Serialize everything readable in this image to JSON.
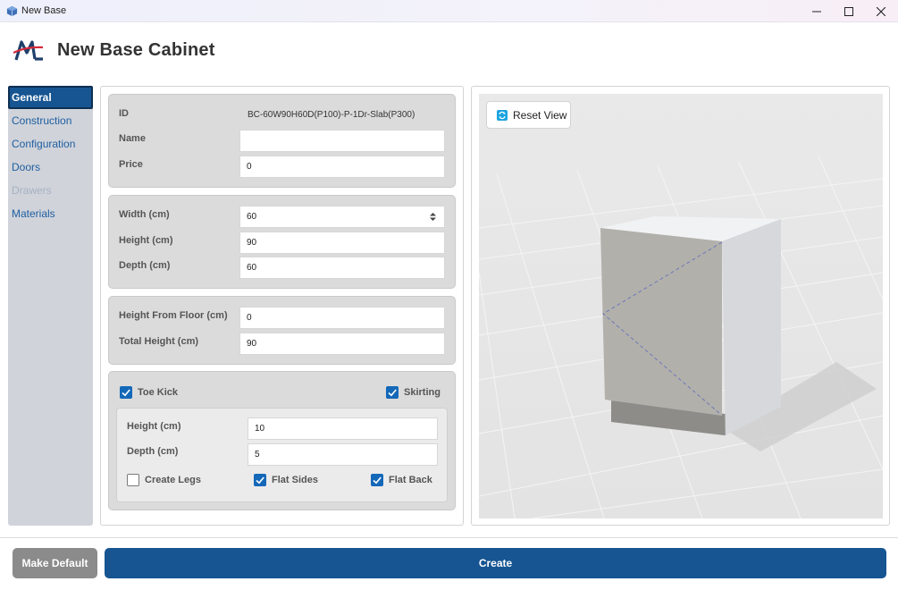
{
  "window": {
    "title": "New Base",
    "icon": "app-cube-icon"
  },
  "header": {
    "title": "New Base Cabinet",
    "logo": "ml-logo-icon"
  },
  "sidebar": {
    "items": [
      {
        "label": "General",
        "state": "active"
      },
      {
        "label": "Construction",
        "state": "normal"
      },
      {
        "label": "Configuration",
        "state": "normal"
      },
      {
        "label": "Doors",
        "state": "normal"
      },
      {
        "label": "Drawers",
        "state": "disabled"
      },
      {
        "label": "Materials",
        "state": "normal"
      }
    ]
  },
  "general": {
    "id_label": "ID",
    "id_value": "BC-60W90H60D(P100)-P-1Dr-Slab(P300)",
    "name_label": "Name",
    "name_value": "",
    "price_label": "Price",
    "price_value": "0"
  },
  "dimensions": {
    "width_label": "Width (cm)",
    "width_value": "60",
    "height_label": "Height (cm)",
    "height_value": "90",
    "depth_label": "Depth (cm)",
    "depth_value": "60"
  },
  "placement": {
    "floor_label": "Height From Floor (cm)",
    "floor_value": "0",
    "total_label": "Total Height (cm)",
    "total_value": "90"
  },
  "toe_kick": {
    "label": "Toe Kick",
    "checked": true,
    "skirting_label": "Skirting",
    "skirting_checked": true,
    "height_label": "Height (cm)",
    "height_value": "10",
    "depth_label": "Depth (cm)",
    "depth_value": "5",
    "create_legs_label": "Create Legs",
    "create_legs_checked": false,
    "flat_sides_label": "Flat Sides",
    "flat_sides_checked": true,
    "flat_back_label": "Flat Back",
    "flat_back_checked": true
  },
  "viewport": {
    "reset_label": "Reset View",
    "reset_icon": "refresh-icon"
  },
  "footer": {
    "make_default_label": "Make Default",
    "create_label": "Create"
  },
  "colors": {
    "primary": "#165592",
    "checkbox": "#1468b8",
    "secondary_button": "#8b8b8b",
    "sidebar_bg": "#d0d3da"
  }
}
